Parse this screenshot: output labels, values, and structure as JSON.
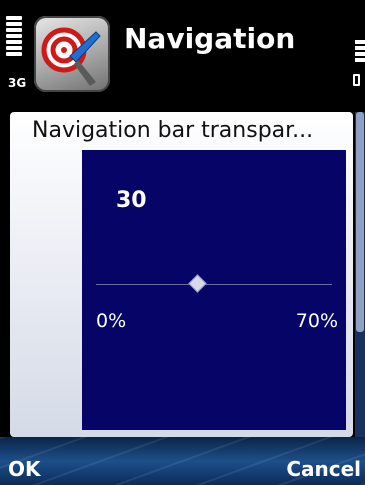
{
  "status": {
    "network_type": "3G"
  },
  "header": {
    "title": "Navigation",
    "icon": "navigation-app-icon"
  },
  "dialog": {
    "title": "Navigation bar transpar...",
    "slider": {
      "value": "30",
      "min_label": "0%",
      "max_label": "70%",
      "level_fraction": 0.43
    }
  },
  "softkeys": {
    "left": "OK",
    "right": "Cancel"
  },
  "colors": {
    "panel_bg": "#060466",
    "softkey_bg": "#1d4f8a",
    "text_light": "#ffffff"
  }
}
